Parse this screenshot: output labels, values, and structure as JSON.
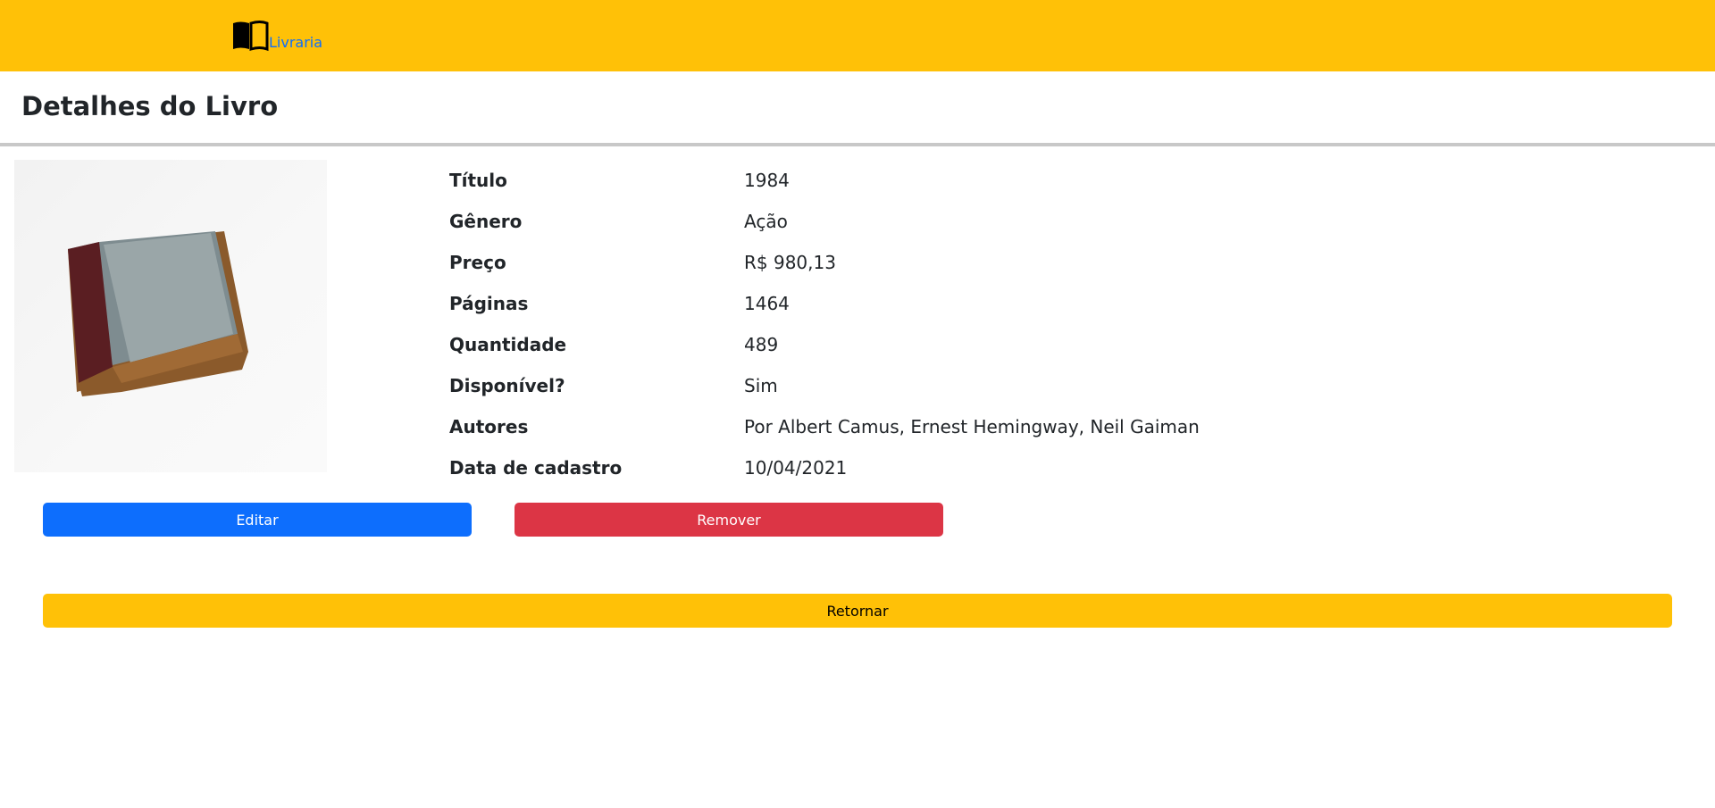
{
  "navbar": {
    "brand": "Livraria",
    "brand_icon": "book-icon",
    "color": "#ffc107"
  },
  "page_title": "Detalhes do Livro",
  "book_image": {
    "alt": "book-photo"
  },
  "details": [
    {
      "label": "Título",
      "value": "1984"
    },
    {
      "label": "Gênero",
      "value": "Ação"
    },
    {
      "label": "Preço",
      "value": "R$ 980,13"
    },
    {
      "label": "Páginas",
      "value": "1464"
    },
    {
      "label": "Quantidade",
      "value": "489"
    },
    {
      "label": "Disponível?",
      "value": "Sim"
    },
    {
      "label": "Autores",
      "value": "Por Albert Camus, Ernest Hemingway, Neil Gaiman"
    },
    {
      "label": "Data de cadastro",
      "value": "10/04/2021"
    }
  ],
  "actions": {
    "edit": "Editar",
    "remove": "Remover",
    "back": "Retornar"
  },
  "colors": {
    "primary": "#0d6efd",
    "danger": "#dc3545",
    "warning": "#ffc107"
  }
}
